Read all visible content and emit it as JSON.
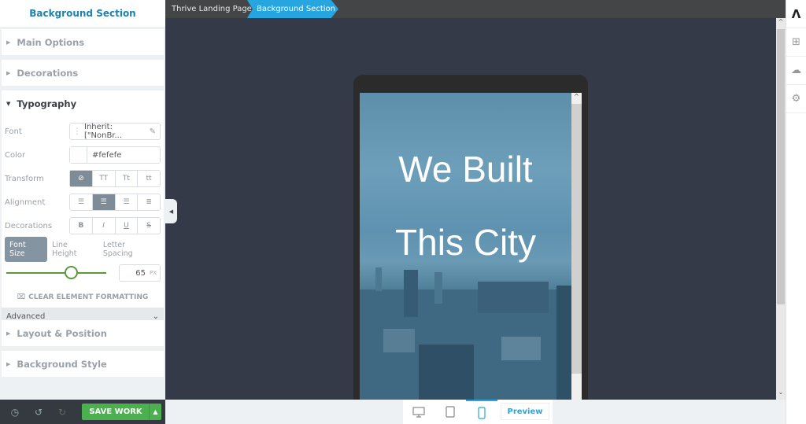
{
  "sidebar": {
    "title": "Background Section",
    "panels": {
      "main_options": "Main Options",
      "decorations": "Decorations",
      "typography": "Typography",
      "layout": "Layout & Position",
      "background": "Background Style"
    },
    "typography": {
      "font_label": "Font",
      "font_value": "Inherit: [\"NonBr...",
      "color_label": "Color",
      "color_value": "#fefefe",
      "transform_label": "Transform",
      "transform_options": [
        "⊘",
        "TT",
        "Tt",
        "tt"
      ],
      "transform_selected": 0,
      "alignment_label": "Alignment",
      "alignment_selected": 1,
      "decorations_label": "Decorations",
      "decoration_options": [
        "B",
        "I",
        "U",
        "S"
      ],
      "size_tabs": [
        "Font Size",
        "Line Height",
        "Letter Spacing"
      ],
      "font_size_value": "65",
      "font_size_unit": "PX",
      "clear_label": "CLEAR ELEMENT FORMATTING",
      "advanced_label": "Advanced"
    },
    "save_label": "SAVE WORK"
  },
  "breadcrumb": [
    "Thrive Landing Page",
    "Background Section"
  ],
  "canvas": {
    "headline_line1": "We Built",
    "headline_line2": "This City"
  },
  "bottom": {
    "preview_label": "Preview",
    "active_device": "mobile"
  }
}
